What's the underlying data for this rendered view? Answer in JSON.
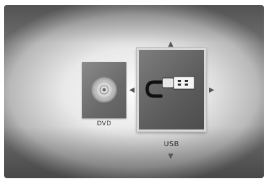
{
  "menu": {
    "items": [
      {
        "label": "DVD",
        "icon": "disc-icon"
      },
      {
        "label": "USB",
        "icon": "usb-plug-icon",
        "selected": true
      }
    ]
  },
  "nav_arrows": {
    "up": "▲",
    "down": "▼",
    "left": "◀",
    "right": "▶"
  },
  "colors": {
    "tile_bg": "#6a6a6a",
    "selected_border": "#d8d8d8",
    "background": "#e9e9e9"
  }
}
